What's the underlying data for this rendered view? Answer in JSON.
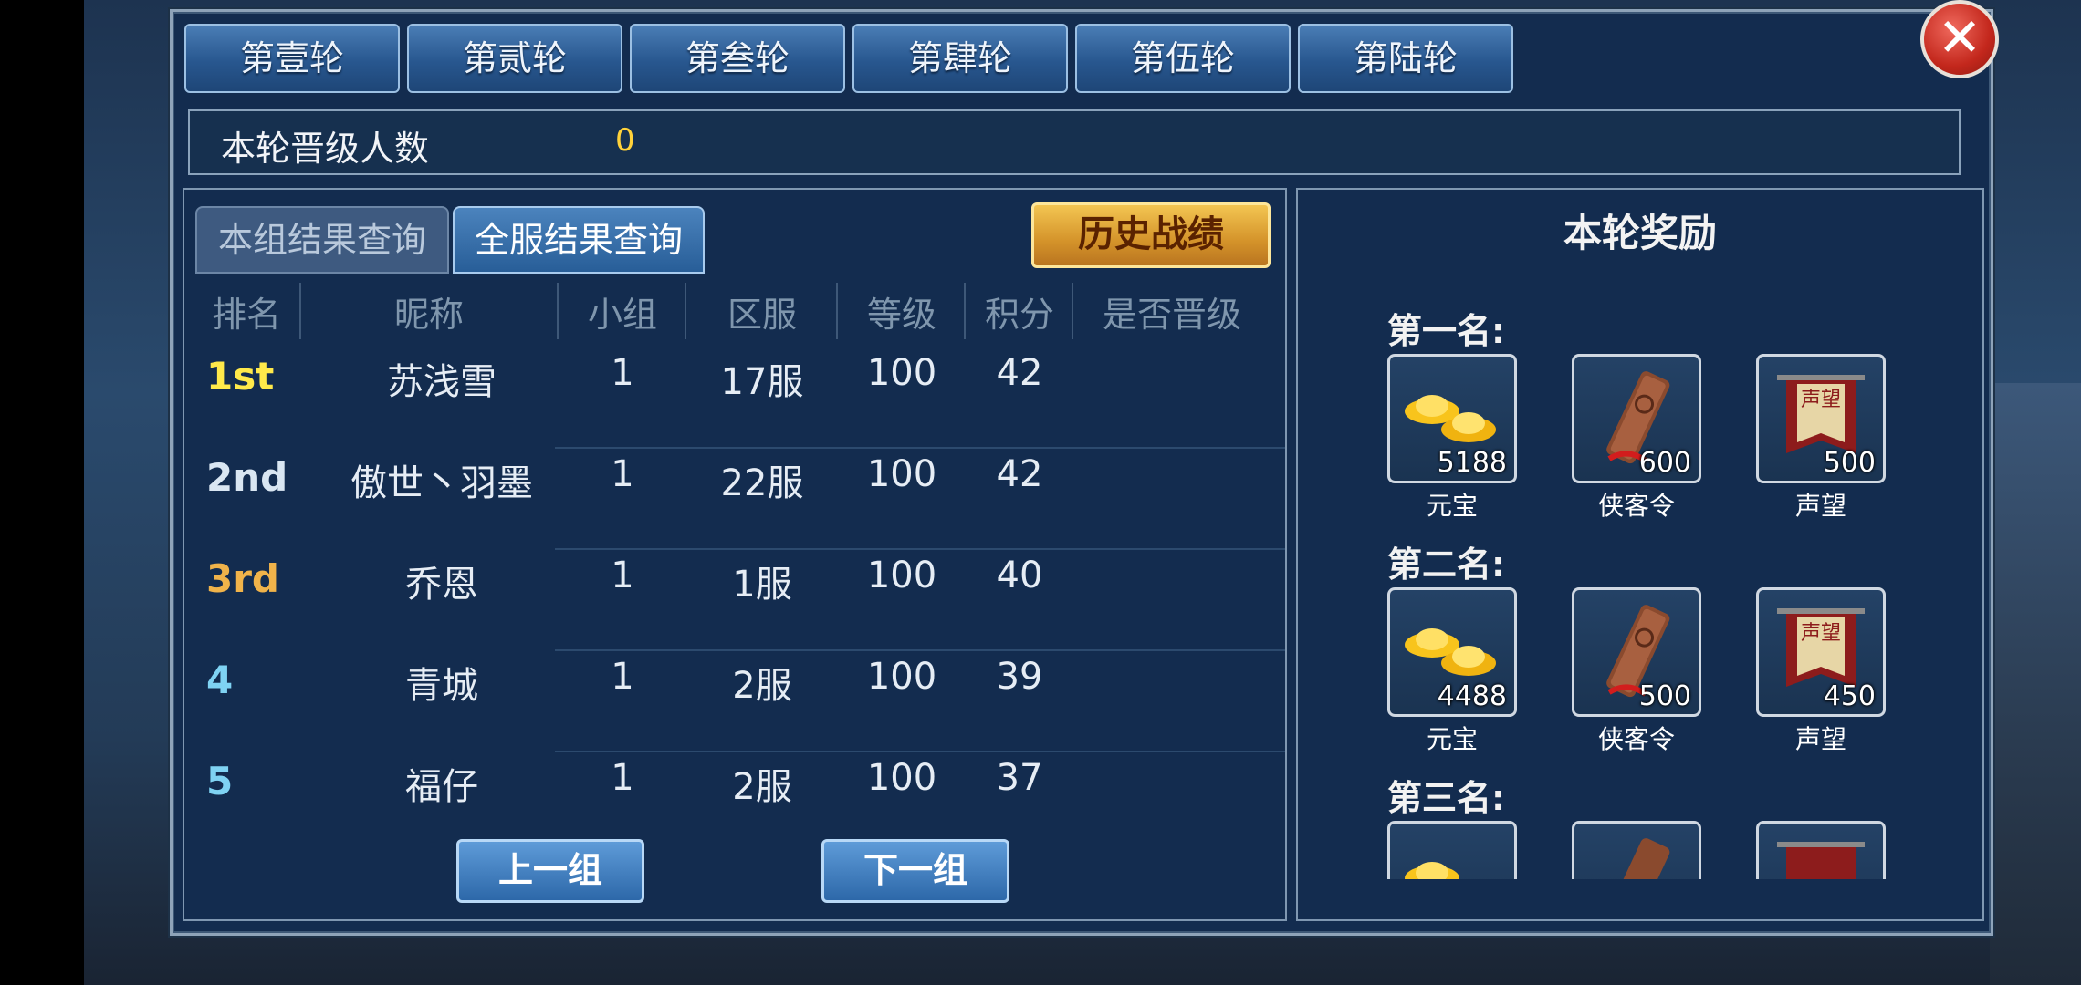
{
  "round_tabs": [
    "第壹轮",
    "第贰轮",
    "第叁轮",
    "第肆轮",
    "第伍轮",
    "第陆轮"
  ],
  "close_label": "✕",
  "promotion": {
    "label": "本轮晋级人数",
    "value": "0"
  },
  "sub_tabs": {
    "group": "本组结果查询",
    "server": "全服结果查询"
  },
  "history_button": "历史战绩",
  "table": {
    "headers": [
      "排名",
      "昵称",
      "小组",
      "区服",
      "等级",
      "积分",
      "是否晋级"
    ],
    "rows": [
      {
        "rank": "1st",
        "name": "苏浅雪",
        "group": "1",
        "server": "17服",
        "level": "100",
        "score": "42",
        "promoted": ""
      },
      {
        "rank": "2nd",
        "name": "傲世丶羽墨",
        "group": "1",
        "server": "22服",
        "level": "100",
        "score": "42",
        "promoted": ""
      },
      {
        "rank": "3rd",
        "name": "乔恩",
        "group": "1",
        "server": "1服",
        "level": "100",
        "score": "40",
        "promoted": ""
      },
      {
        "rank": "4",
        "name": "青城",
        "group": "1",
        "server": "2服",
        "level": "100",
        "score": "39",
        "promoted": ""
      },
      {
        "rank": "5",
        "name": "福仔",
        "group": "1",
        "server": "2服",
        "level": "100",
        "score": "37",
        "promoted": ""
      }
    ],
    "rank_colors": [
      "#ffe94a",
      "#d9e6f2",
      "#f0b34a",
      "#7fd3f3",
      "#7fd3f3"
    ]
  },
  "nav": {
    "prev": "上一组",
    "next": "下一组"
  },
  "rewards": {
    "title": "本轮奖励",
    "places": [
      {
        "label": "第一名:",
        "items": [
          {
            "name": "元宝",
            "qty": "5188",
            "icon": "gold-ingot-icon"
          },
          {
            "name": "侠客令",
            "qty": "600",
            "icon": "hero-token-icon"
          },
          {
            "name": "声望",
            "qty": "500",
            "icon": "reputation-banner-icon"
          }
        ]
      },
      {
        "label": "第二名:",
        "items": [
          {
            "name": "元宝",
            "qty": "4488",
            "icon": "gold-ingot-icon"
          },
          {
            "name": "侠客令",
            "qty": "500",
            "icon": "hero-token-icon"
          },
          {
            "name": "声望",
            "qty": "450",
            "icon": "reputation-banner-icon"
          }
        ]
      },
      {
        "label": "第三名:",
        "items": [
          {
            "name": "元宝",
            "qty": "",
            "icon": "gold-ingot-icon"
          },
          {
            "name": "侠客令",
            "qty": "",
            "icon": "hero-token-icon"
          },
          {
            "name": "声望",
            "qty": "",
            "icon": "reputation-banner-icon"
          }
        ]
      }
    ],
    "banner_text": "声望"
  }
}
